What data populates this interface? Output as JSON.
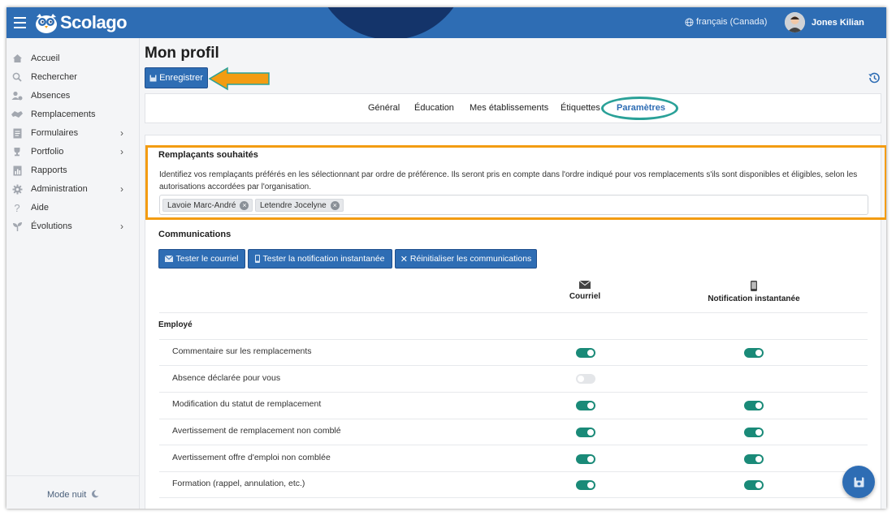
{
  "header": {
    "brand": "Scolago",
    "language": "français (Canada)",
    "user_name": "Jones Kilian",
    "colors": {
      "bar": "#2e6db4",
      "accent_blob": "#14346a"
    }
  },
  "sidebar": {
    "items": [
      {
        "label": "Accueil",
        "icon": "home-icon",
        "has_submenu": false
      },
      {
        "label": "Rechercher",
        "icon": "search-icon",
        "has_submenu": false
      },
      {
        "label": "Absences",
        "icon": "user-absence-icon",
        "has_submenu": false
      },
      {
        "label": "Remplacements",
        "icon": "handshake-icon",
        "has_submenu": false
      },
      {
        "label": "Formulaires",
        "icon": "form-icon",
        "has_submenu": true
      },
      {
        "label": "Portfolio",
        "icon": "trophy-icon",
        "has_submenu": true
      },
      {
        "label": "Rapports",
        "icon": "report-icon",
        "has_submenu": false
      },
      {
        "label": "Administration",
        "icon": "gear-icon",
        "has_submenu": true
      },
      {
        "label": "Aide",
        "icon": "question-icon",
        "has_submenu": false
      },
      {
        "label": "Évolutions",
        "icon": "sprout-icon",
        "has_submenu": true
      }
    ],
    "chevron": "›",
    "night_mode": "Mode nuit"
  },
  "page": {
    "title": "Mon profil",
    "save_label": "Enregistrer"
  },
  "tabs": [
    {
      "label": "Général",
      "active": false
    },
    {
      "label": "Éducation",
      "active": false
    },
    {
      "label": "Mes établissements",
      "active": false
    },
    {
      "label": "Étiquettes",
      "active": false
    },
    {
      "label": "Paramètres",
      "active": true
    }
  ],
  "preferred": {
    "title": "Remplaçants souhaités",
    "description": "Identifiez vos remplaçants préférés en les sélectionnant par ordre de préférence. Ils seront pris en compte dans l'ordre indiqué pour vos remplacements s'ils sont disponibles et éligibles, selon les autorisations accordées par l'organisation.",
    "tags": [
      "Lavoie Marc-André",
      "Letendre Jocelyne"
    ]
  },
  "communications": {
    "title": "Communications",
    "buttons": {
      "test_email": "Tester le courriel",
      "test_push": "Tester la notification instantanée",
      "reset": "Réinitialiser les communications"
    },
    "columns": {
      "email": "Courriel",
      "push": "Notification instantanée"
    },
    "group": "Employé",
    "rows": [
      {
        "label": "Commentaire sur les remplacements",
        "email": "on",
        "push": "on"
      },
      {
        "label": "Absence déclarée pour vous",
        "email": "off",
        "push": "none"
      },
      {
        "label": "Modification du statut de remplacement",
        "email": "on",
        "push": "on"
      },
      {
        "label": "Avertissement de remplacement non comblé",
        "email": "on",
        "push": "on"
      },
      {
        "label": "Avertissement offre d'emploi non comblée",
        "email": "on",
        "push": "on"
      },
      {
        "label": "Formation (rappel, annulation, etc.)",
        "email": "on",
        "push": "on"
      }
    ],
    "toggle_color_on": "#1a8a78"
  }
}
